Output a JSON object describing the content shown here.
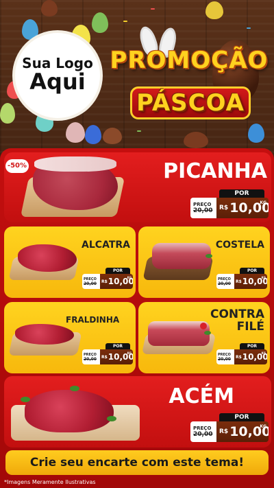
{
  "logo": {
    "line1": "Sua Logo",
    "line2": "Aqui"
  },
  "title": {
    "line1": "PROMOÇÃO",
    "line2": "PÁSCOA"
  },
  "colors": {
    "red": "#c40f0f",
    "yellow": "#ffd31f",
    "price_brown": "#6a250a",
    "wood": "#4a2815"
  },
  "discount_badge": "-50%",
  "products": [
    {
      "name": "PICANHA",
      "por": "POR",
      "preco_label": "PREÇO",
      "old_price": "20,00",
      "currency": "R$",
      "price": "10,00",
      "unit": "KG"
    },
    {
      "name": "ALCATRA",
      "por": "POR",
      "preco_label": "PREÇO",
      "old_price": "20,00",
      "currency": "R$",
      "price": "10,00",
      "unit": "KG"
    },
    {
      "name": "COSTELA",
      "por": "POR",
      "preco_label": "PREÇO",
      "old_price": "20,00",
      "currency": "R$",
      "price": "10,00",
      "unit": "KG"
    },
    {
      "name": "FRALDINHA",
      "por": "POR",
      "preco_label": "PREÇO",
      "old_price": "20,00",
      "currency": "R$",
      "price": "10,00",
      "unit": "KG"
    },
    {
      "name_line1": "CONTRA",
      "name_line2": "FILÉ",
      "por": "POR",
      "preco_label": "PREÇO",
      "old_price": "20,00",
      "currency": "R$",
      "price": "10,00",
      "unit": "KG"
    },
    {
      "name": "ACÉM",
      "por": "POR",
      "preco_label": "PREÇO",
      "old_price": "20,00",
      "currency": "R$",
      "price": "10,00",
      "unit": "KG"
    }
  ],
  "cta": "Crie seu encarte com este tema!",
  "disclaimer": "*Imagens Meramente Ilustrativas"
}
